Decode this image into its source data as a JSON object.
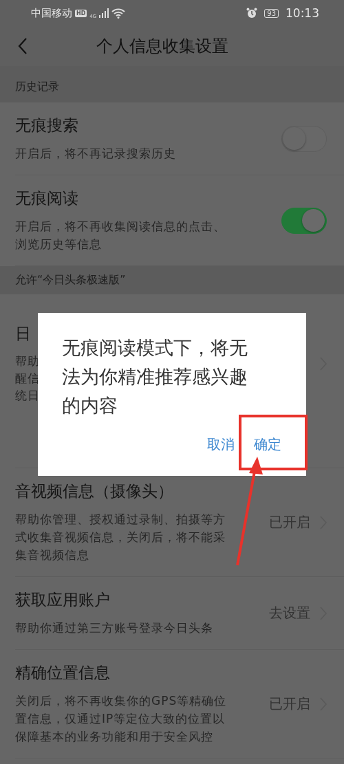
{
  "status_bar": {
    "carrier": "中国移动",
    "hd": "HD",
    "network": "4G",
    "battery": "93",
    "time": "10:13"
  },
  "nav": {
    "title": "个人信息收集设置"
  },
  "sections": [
    {
      "header": "历史记录",
      "rows": [
        {
          "kind": "toggle",
          "title": "无痕搜索",
          "description": "开启后，将不再记录搜索历史",
          "on": false
        },
        {
          "kind": "toggle",
          "title": "无痕阅读",
          "description": "开启后，将不再收集阅读信息的点击、浏览历史等信息",
          "on": true
        }
      ]
    },
    {
      "header": "允许“今日头条极速版”",
      "rows": [
        {
          "kind": "partial",
          "title": "日",
          "description": "帮助醒信统日"
        },
        {
          "kind": "link",
          "title": "音视频信息（摄像头）",
          "description": "帮助你管理、授权通过录制、拍摄等方式收集音视频信息，关闭后，将不能采集音视频信息",
          "value": "已开启"
        },
        {
          "kind": "link",
          "title": "获取应用账户",
          "description": "帮助你通过第三方账号登录今日头条",
          "value": "去设置"
        },
        {
          "kind": "link",
          "title": "精确位置信息",
          "description": "关闭后，将不再收集你的GPS等精确位置信息，仅通过IP等定位大致的位置以保障基本的业务功能和用于安全风控",
          "value": "已开启"
        }
      ]
    }
  ],
  "dialog": {
    "message": "无痕阅读模式下，将无法为你精准推荐感兴趣的内容",
    "buttons": [
      {
        "label": "取消",
        "highlighted": false
      },
      {
        "label": "确定",
        "highlighted": true
      }
    ]
  }
}
